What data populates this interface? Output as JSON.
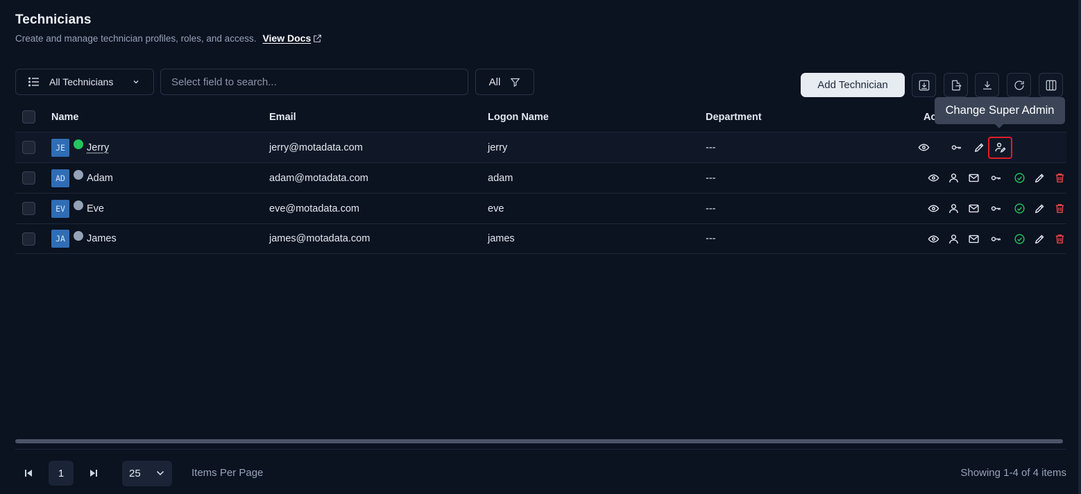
{
  "page": {
    "title": "Technicians",
    "subtitle": "Create and manage technician profiles, roles, and access.",
    "docs_link": "View Docs"
  },
  "toolbar": {
    "view_label": "All Technicians",
    "search_placeholder": "Select field to search...",
    "filter_label": "All",
    "add_label": "Add Technician"
  },
  "table": {
    "headers": {
      "name": "Name",
      "email": "Email",
      "logon": "Logon Name",
      "department": "Department",
      "actions": "Ac"
    },
    "rows": [
      {
        "initials": "JE",
        "name": "Jerry",
        "online": true,
        "email": "jerry@motadata.com",
        "logon": "jerry",
        "department": "---"
      },
      {
        "initials": "AD",
        "name": "Adam",
        "online": false,
        "email": "adam@motadata.com",
        "logon": "adam",
        "department": "---"
      },
      {
        "initials": "EV",
        "name": "Eve",
        "online": false,
        "email": "eve@motadata.com",
        "logon": "eve",
        "department": "---"
      },
      {
        "initials": "JA",
        "name": "James",
        "online": false,
        "email": "james@motadata.com",
        "logon": "james",
        "department": "---"
      }
    ]
  },
  "tooltip": "Change Super Admin",
  "pagination": {
    "current_page": "1",
    "per_page": "25",
    "per_page_label": "Items Per Page",
    "showing": "Showing 1-4 of 4 items"
  },
  "colors": {
    "background": "#0b1220",
    "online": "#22c55e",
    "offline": "#94a3b8",
    "success": "#22c55e",
    "danger": "#ef4444",
    "highlight": "#e11d2a"
  }
}
